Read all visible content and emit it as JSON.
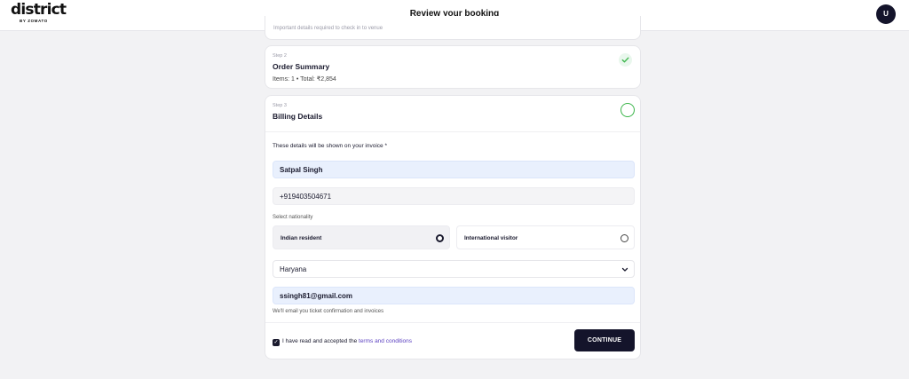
{
  "header": {
    "logo_text": "district",
    "logo_subtext": "BY ZOMATO",
    "title": "Review your booking",
    "avatar_initial": "U"
  },
  "step1": {
    "cut_text": "Important details required to check in to venue"
  },
  "step2": {
    "step_label": "Step 2",
    "title": "Order Summary",
    "summary": "Items: 1 • Total: ₹2,854",
    "status_icon": "check-icon",
    "status_color": "#3bb54a"
  },
  "step3": {
    "step_label": "Step 3",
    "title": "Billing Details",
    "notice": "These details will be shown on your invoice *",
    "name_value": "Satpal Singh",
    "phone_value": "+919403504671",
    "nationality_label": "Select nationality",
    "nationality_options": [
      {
        "label": "Indian resident",
        "selected": true
      },
      {
        "label": "International visitor",
        "selected": false
      }
    ],
    "state_value": "Haryana",
    "email_value": "ssingh81@gmail.com",
    "email_helper": "We'll email you ticket confirmation and invoices",
    "terms_prefix": "I have read and accepted the",
    "terms_link": "terms and conditions",
    "terms_checked": true,
    "continue_label": "CONTINUE"
  },
  "colors": {
    "accent_dark": "#14142b",
    "success_green": "#3bb54a",
    "link_purple": "#5a3fc0",
    "input_blue": "#e9f0fd"
  }
}
